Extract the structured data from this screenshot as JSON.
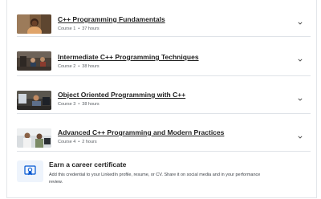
{
  "courses": [
    {
      "title": "C++ Programming Fundamentals",
      "course_label": "Course 1",
      "duration": "37 hours",
      "thumbnail": "woman-smiling-photo"
    },
    {
      "title": "Intermediate C++ Programming Techniques",
      "course_label": "Course 2",
      "duration": "38 hours",
      "thumbnail": "workshop-photo"
    },
    {
      "title": "Object Oriented Programming with C++",
      "course_label": "Course 3",
      "duration": "38 hours",
      "thumbnail": "man-at-computer-photo"
    },
    {
      "title": "Advanced C++ Programming and Modern Practices",
      "course_label": "Course 4",
      "duration": "2 hours",
      "thumbnail": "two-people-photo"
    }
  ],
  "separator": "•",
  "expand_icon": "chevron-down-icon",
  "certificate": {
    "title": "Earn a career certificate",
    "description": "Add this credential to your LinkedIn profile, resume, or CV. Share it on social media and in your performance review.",
    "icon": "certificate-icon"
  },
  "colors": {
    "accent": "#0056d2",
    "text": "#1f1f1f",
    "muted": "#5b6066",
    "divider": "#dfe3e8",
    "icon_bg": "#eef4fc"
  }
}
